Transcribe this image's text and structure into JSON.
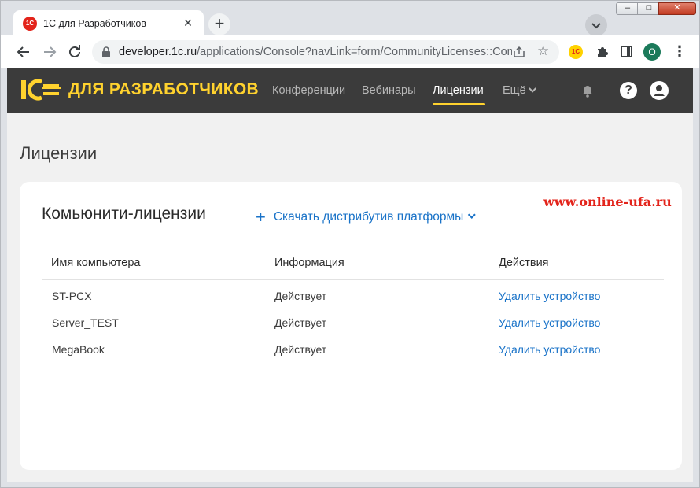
{
  "browser": {
    "tab_title": "1С для Разработчиков",
    "tab_favicon_text": "1С",
    "url_host": "developer.1c.ru",
    "url_path": "/applications/Console?navLink=form/CommunityLicenses::Com...",
    "profile_initial": "O",
    "ext_1c_text": "1С",
    "window_controls": {
      "minimize": "–",
      "maximize": "□",
      "close": "✕"
    }
  },
  "site": {
    "logo_text": "ДЛЯ РАЗРАБОТЧИКОВ",
    "logo_mark_text": "1С",
    "nav": [
      {
        "label": "Конференции",
        "active": false
      },
      {
        "label": "Вебинары",
        "active": false
      },
      {
        "label": "Лицензии",
        "active": true
      },
      {
        "label": "Ещё",
        "active": false
      }
    ],
    "help_symbol": "?"
  },
  "page": {
    "title": "Лицензии",
    "card": {
      "title": "Комьюнити-лицензии",
      "download_label": "Скачать дистрибутив платформы",
      "download_plus": "+",
      "watermark": "www.online-ufa.ru",
      "columns": [
        "Имя компьютера",
        "Информация",
        "Действия"
      ],
      "rows": [
        {
          "computer": "ST-PCX",
          "info": "Действует",
          "action": "Удалить устройство"
        },
        {
          "computer": "Server_TEST",
          "info": "Действует",
          "action": "Удалить устройство"
        },
        {
          "computer": "MegaBook",
          "info": "Действует",
          "action": "Удалить устройство"
        }
      ]
    }
  },
  "colors": {
    "header_bg": "#3b3b3b",
    "brand_yellow": "#ffd22e",
    "link_blue": "#1a73c8",
    "watermark_red": "#e3241b"
  }
}
